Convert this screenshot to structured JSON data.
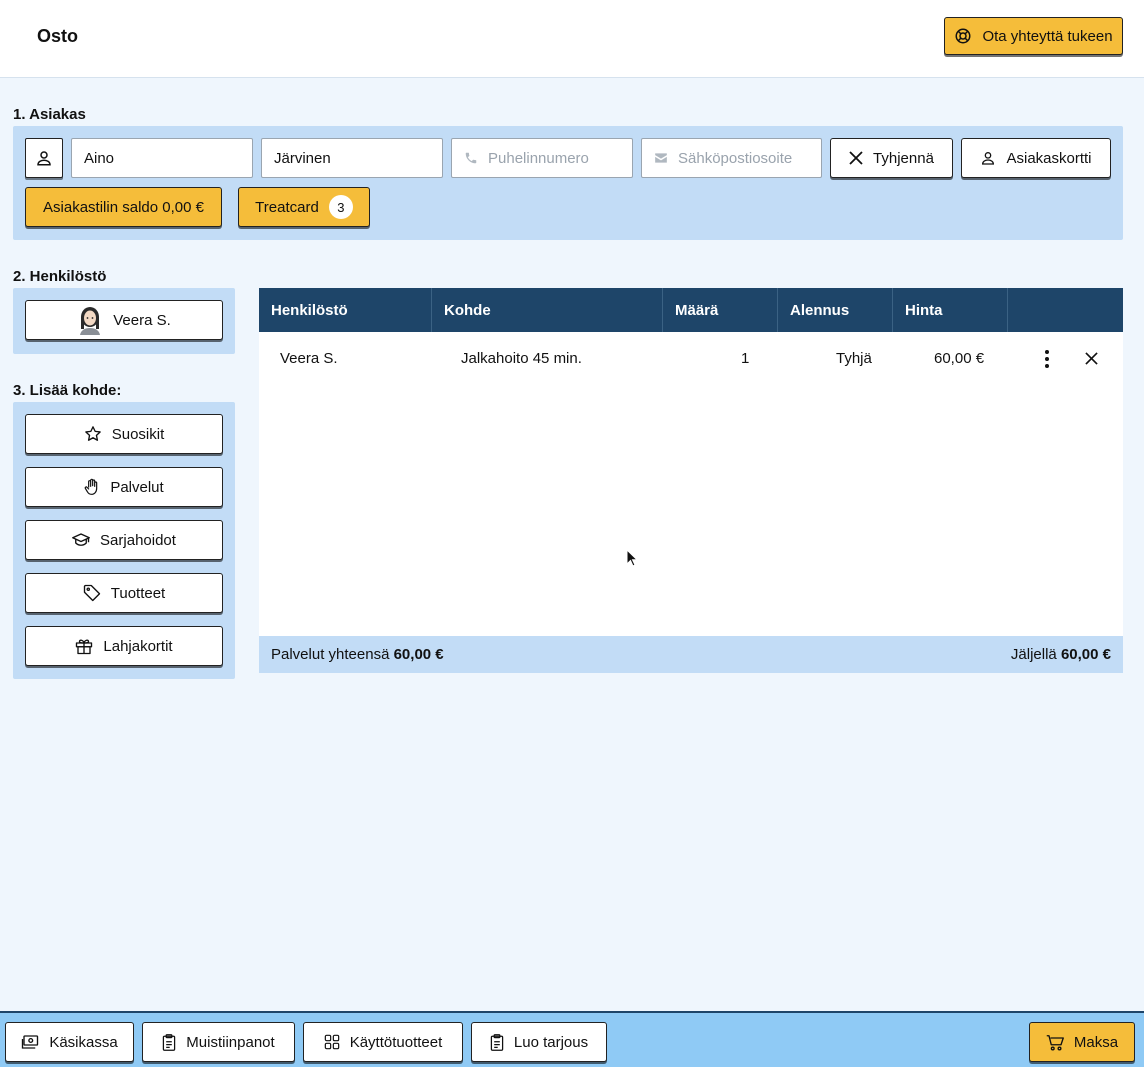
{
  "header": {
    "title": "Osto",
    "support_label": "Ota yhteyttä tukeen"
  },
  "customer": {
    "section_label": "1. Asiakas",
    "first_name": "Aino",
    "last_name": "Järvinen",
    "phone_placeholder": "Puhelinnumero",
    "email_placeholder": "Sähköpostiosoite",
    "clear_label": "Tyhjennä",
    "card_label": "Asiakaskortti",
    "balance_label": "Asiakastilin saldo 0,00 €",
    "treatcard_label": "Treatcard",
    "treatcard_count": "3"
  },
  "staff": {
    "section_label": "2. Henkilöstö",
    "selected": "Veera S."
  },
  "add_item": {
    "section_label": "3. Lisää kohde:",
    "buttons": [
      {
        "label": "Suosikit",
        "icon": "star-icon"
      },
      {
        "label": "Palvelut",
        "icon": "hand-icon"
      },
      {
        "label": "Sarjahoidot",
        "icon": "graduation-cap-icon"
      },
      {
        "label": "Tuotteet",
        "icon": "tag-icon"
      },
      {
        "label": "Lahjakortit",
        "icon": "gift-icon"
      }
    ]
  },
  "table": {
    "headers": [
      "Henkilöstö",
      "Kohde",
      "Määrä",
      "Alennus",
      "Hinta",
      ""
    ],
    "rows": [
      {
        "staff": "Veera S.",
        "item": "Jalkahoito 45 min.",
        "qty": "1",
        "discount": "Tyhjä",
        "price": "60,00 €"
      }
    ],
    "footer": {
      "services_total_label": "Palvelut yhteensä",
      "services_total_value": "60,00 €",
      "remaining_label": "Jäljellä",
      "remaining_value": "60,00 €"
    }
  },
  "bottom": {
    "cash_label": "Käsikassa",
    "notes_label": "Muistiinpanot",
    "consumables_label": "Käyttötuotteet",
    "offer_label": "Luo tarjous",
    "pay_label": "Maksa"
  },
  "colors": {
    "accent": "#f5bd3a",
    "header_dark": "#1e4569",
    "panel": "#c2dcf6",
    "background": "#eff6fd",
    "bottom_bar": "#8fcaf5"
  }
}
